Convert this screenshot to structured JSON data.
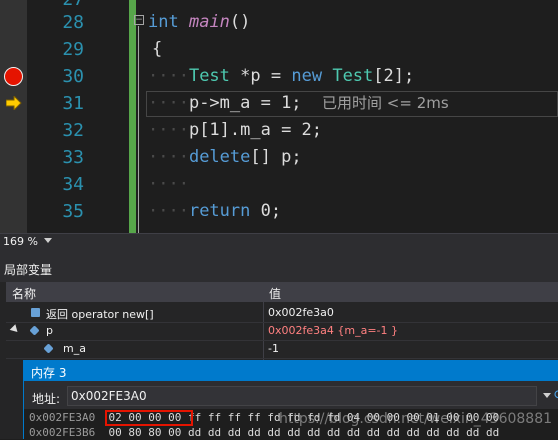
{
  "editor": {
    "lines": [
      {
        "num": "27"
      },
      {
        "num": "28"
      },
      {
        "num": "29"
      },
      {
        "num": "30"
      },
      {
        "num": "31"
      },
      {
        "num": "32"
      },
      {
        "num": "33"
      },
      {
        "num": "34"
      },
      {
        "num": "35"
      }
    ],
    "code": {
      "l28_kw": "int",
      "l28_fn": "main",
      "l28_paren": "()",
      "l29": "{",
      "l30_type": "Test",
      "l30_ptr": " *p ",
      "l30_eq": "=",
      "l30_new": "new",
      "l30_type2": "Test",
      "l30_rest": "[2];",
      "l31_code": "p->m_a = 1;",
      "l31_hint": "已用时间 <= 2ms",
      "l32_code": "p[1].m_a = 2;",
      "l33_kw": "delete",
      "l33_rest": "[] p;",
      "l35_kw": "return",
      "l35_rest": " 0;"
    },
    "breakpoint_line": "30",
    "current_line": "31"
  },
  "zoom": {
    "level": "169 %"
  },
  "locals": {
    "title": "局部变量",
    "columns": {
      "name": "名称",
      "value": "值"
    },
    "rows": [
      {
        "name": "返回 operator new[]",
        "value": "0x002fe3a0"
      },
      {
        "name": "p",
        "value": "0x002fe3a4 {m_a=-1 }"
      },
      {
        "name": "m_a",
        "value": "-1"
      }
    ]
  },
  "memory": {
    "title": "内存 3",
    "address_label": "地址:",
    "address_value": "0x002FE3A0",
    "rows": [
      {
        "addr": "0x002FE3A0",
        "bytes": "02 00 00 00 ff ff ff ff fd fd fd fd 04 00 00 00 01 00 00 00"
      },
      {
        "addr": "0x002FE3B6",
        "bytes": "00 80 80 00 dd dd dd dd dd dd dd dd dd dd dd dd dd dd dd dd"
      }
    ],
    "watermark": "https://blog.csdn.net/weixin_43608881"
  },
  "colors": {
    "breakpoint": "#e51400",
    "accent": "#007acc",
    "changed_value": "#ff8080"
  }
}
